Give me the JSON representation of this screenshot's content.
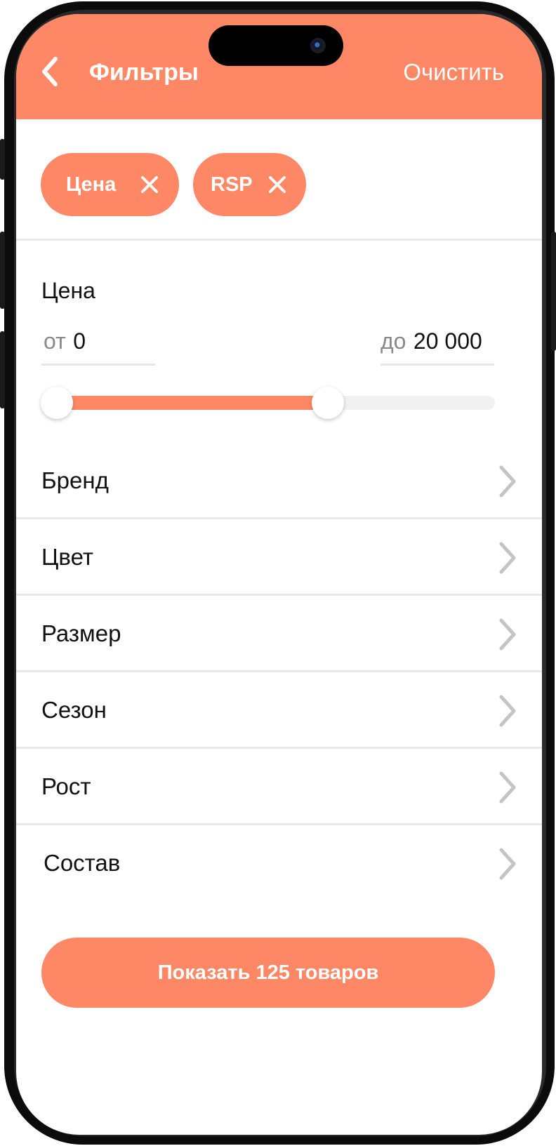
{
  "header": {
    "title": "Фильтры",
    "clear_label": "Очистить"
  },
  "chips": [
    {
      "label": "Цена"
    },
    {
      "label": "RSP"
    }
  ],
  "price": {
    "title": "Цена",
    "from_prefix": "от",
    "from_value": "0",
    "to_prefix": "до",
    "to_value": "20 000",
    "slider_range_fraction": [
      0.0,
      0.6
    ]
  },
  "filters": [
    {
      "label": "Бренд"
    },
    {
      "label": "Цвет"
    },
    {
      "label": "Размер"
    },
    {
      "label": "Сезон"
    },
    {
      "label": "Рост"
    },
    {
      "label": "Состав"
    }
  ],
  "cta": {
    "label": "Показать 125 товаров"
  },
  "colors": {
    "accent": "#fe8866",
    "chevron": "#c4c4c4",
    "divider": "#e8e8e8"
  }
}
